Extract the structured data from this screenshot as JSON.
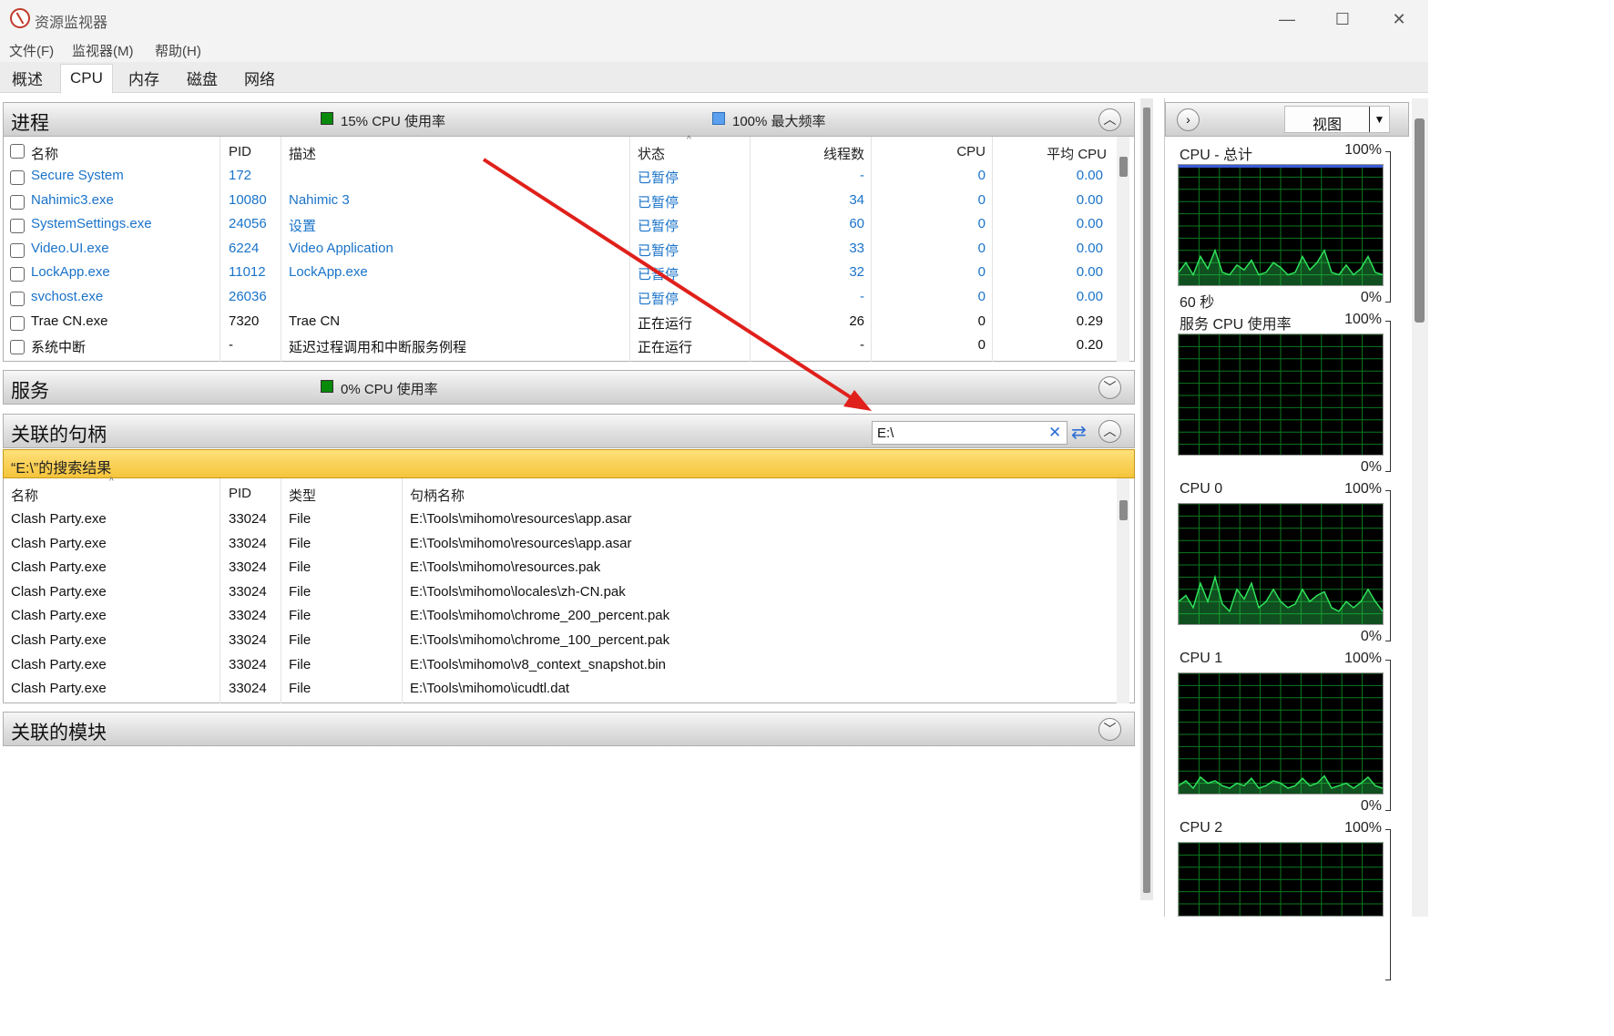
{
  "window": {
    "title": "资源监视器",
    "min": "—",
    "max": "☐",
    "close": "✕"
  },
  "menu": [
    "文件(F)",
    "监视器(M)",
    "帮助(H)"
  ],
  "tabs": [
    "概述",
    "CPU",
    "内存",
    "磁盘",
    "网络"
  ],
  "processes": {
    "title": "进程",
    "cpu_usage": "15% CPU 使用率",
    "max_freq": "100% 最大频率",
    "collapse_icon": "chevron-up-icon",
    "headers": [
      "名称",
      "PID",
      "描述",
      "状态",
      "线程数",
      "CPU",
      "平均 CPU"
    ],
    "rows": [
      {
        "name": "Secure System",
        "pid": "172",
        "desc": "",
        "status": "已暂停",
        "threads": "-",
        "cpu": "0",
        "avg": "0.00",
        "suspended": true
      },
      {
        "name": "Nahimic3.exe",
        "pid": "10080",
        "desc": "Nahimic 3",
        "status": "已暂停",
        "threads": "34",
        "cpu": "0",
        "avg": "0.00",
        "suspended": true
      },
      {
        "name": "SystemSettings.exe",
        "pid": "24056",
        "desc": "设置",
        "status": "已暂停",
        "threads": "60",
        "cpu": "0",
        "avg": "0.00",
        "suspended": true
      },
      {
        "name": "Video.UI.exe",
        "pid": "6224",
        "desc": "Video Application",
        "status": "已暂停",
        "threads": "33",
        "cpu": "0",
        "avg": "0.00",
        "suspended": true
      },
      {
        "name": "LockApp.exe",
        "pid": "11012",
        "desc": "LockApp.exe",
        "status": "已暂停",
        "threads": "32",
        "cpu": "0",
        "avg": "0.00",
        "suspended": true
      },
      {
        "name": "svchost.exe",
        "pid": "26036",
        "desc": "",
        "status": "已暂停",
        "threads": "-",
        "cpu": "0",
        "avg": "0.00",
        "suspended": true
      },
      {
        "name": "Trae CN.exe",
        "pid": "7320",
        "desc": "Trae CN",
        "status": "正在运行",
        "threads": "26",
        "cpu": "0",
        "avg": "0.29",
        "suspended": false
      },
      {
        "name": "系统中断",
        "pid": "-",
        "desc": "延迟过程调用和中断服务例程",
        "status": "正在运行",
        "threads": "-",
        "cpu": "0",
        "avg": "0.20",
        "suspended": false
      }
    ]
  },
  "services": {
    "title": "服务",
    "cpu_usage": "0% CPU 使用率",
    "expand_icon": "chevron-down-icon"
  },
  "handles": {
    "title": "关联的句柄",
    "search_value": "E:\\",
    "clear_icon": "clear-x-icon",
    "refresh_icon": "refresh-icon",
    "result_banner": "“E:\\”的搜索结果",
    "headers": [
      "名称",
      "PID",
      "类型",
      "句柄名称"
    ],
    "rows": [
      {
        "name": "Clash Party.exe",
        "pid": "33024",
        "type": "File",
        "handle": "E:\\Tools\\mihomo\\resources\\app.asar"
      },
      {
        "name": "Clash Party.exe",
        "pid": "33024",
        "type": "File",
        "handle": "E:\\Tools\\mihomo\\resources\\app.asar"
      },
      {
        "name": "Clash Party.exe",
        "pid": "33024",
        "type": "File",
        "handle": "E:\\Tools\\mihomo\\resources.pak"
      },
      {
        "name": "Clash Party.exe",
        "pid": "33024",
        "type": "File",
        "handle": "E:\\Tools\\mihomo\\locales\\zh-CN.pak"
      },
      {
        "name": "Clash Party.exe",
        "pid": "33024",
        "type": "File",
        "handle": "E:\\Tools\\mihomo\\chrome_200_percent.pak"
      },
      {
        "name": "Clash Party.exe",
        "pid": "33024",
        "type": "File",
        "handle": "E:\\Tools\\mihomo\\chrome_100_percent.pak"
      },
      {
        "name": "Clash Party.exe",
        "pid": "33024",
        "type": "File",
        "handle": "E:\\Tools\\mihomo\\v8_context_snapshot.bin"
      },
      {
        "name": "Clash Party.exe",
        "pid": "33024",
        "type": "File",
        "handle": "E:\\Tools\\mihomo\\icudtl.dat"
      }
    ]
  },
  "modules": {
    "title": "关联的模块",
    "expand_icon": "chevron-down-icon"
  },
  "right_pane": {
    "view_label": "视图",
    "graphs": [
      {
        "title": "CPU - 总计",
        "max": "100%",
        "bottom_left": "60 秒",
        "min": "0%"
      },
      {
        "title": "服务 CPU 使用率",
        "max": "100%",
        "bottom_left": "",
        "min": "0%"
      },
      {
        "title": "CPU 0",
        "max": "100%",
        "bottom_left": "",
        "min": "0%"
      },
      {
        "title": "CPU 1",
        "max": "100%",
        "bottom_left": "",
        "min": "0%"
      },
      {
        "title": "CPU 2",
        "max": "100%",
        "bottom_left": "",
        "min": ""
      }
    ]
  },
  "colors": {
    "graph_bg": "#000000",
    "graph_grid": "#0b7a1e",
    "graph_line": "#2ee25a",
    "link_blue": "#1a73c9",
    "banner": "#f5c43a",
    "annotation_arrow": "#e0201b"
  }
}
